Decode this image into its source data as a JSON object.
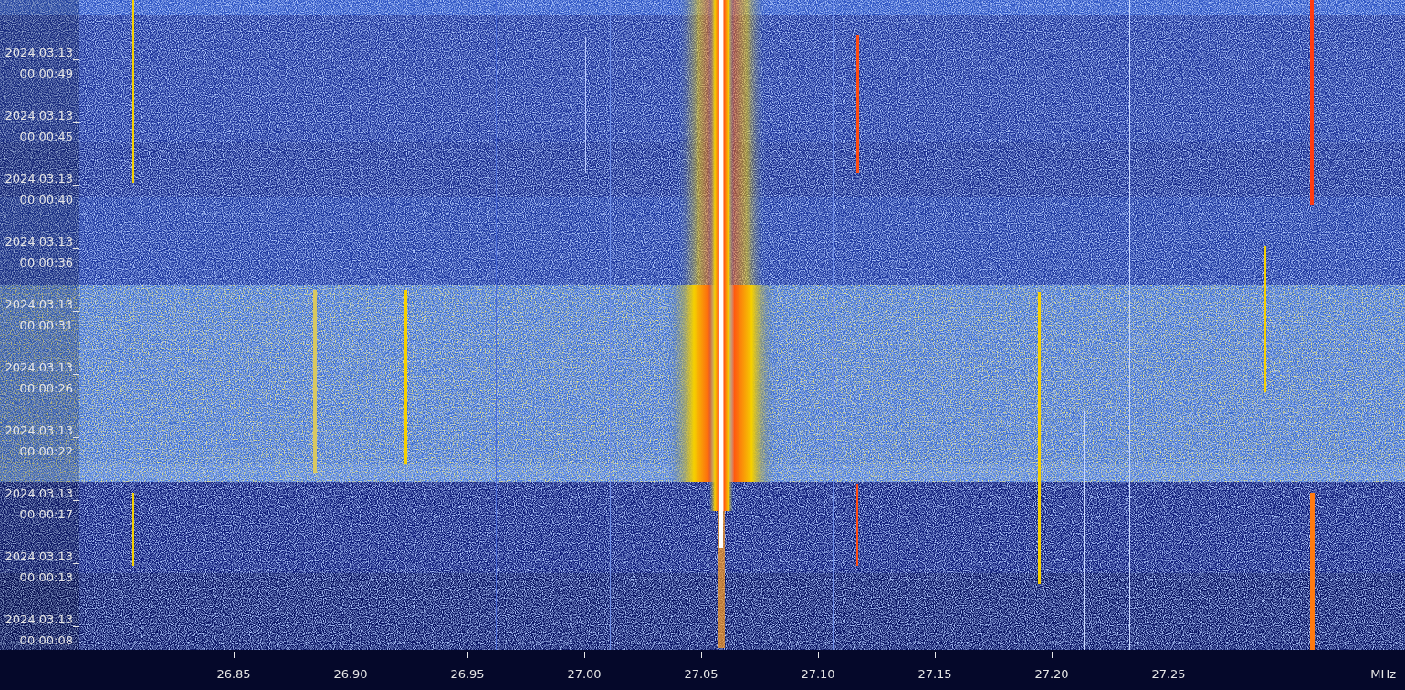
{
  "time_axis": {
    "labels": [
      {
        "date": "2024.03.13",
        "time": "00:00:49"
      },
      {
        "date": "2024.03.13",
        "time": "00:00:45"
      },
      {
        "date": "2024.03.13",
        "time": "00:00:40"
      },
      {
        "date": "2024.03.13",
        "time": "00:00:36"
      },
      {
        "date": "2024.03.13",
        "time": "00:00:31"
      },
      {
        "date": "2024.03.13",
        "time": "00:00:26"
      },
      {
        "date": "2024.03.13",
        "time": "00:00:22"
      },
      {
        "date": "2024.03.13",
        "time": "00:00:17"
      },
      {
        "date": "2024.03.13",
        "time": "00:00:13"
      },
      {
        "date": "2024.03.13",
        "time": "00:00:08"
      }
    ]
  },
  "frequency_axis": {
    "ticks": [
      "26.85",
      "26.90",
      "26.95",
      "27.00",
      "27.05",
      "27.10",
      "27.15",
      "27.20",
      "27.25"
    ],
    "unit": "MHz"
  }
}
